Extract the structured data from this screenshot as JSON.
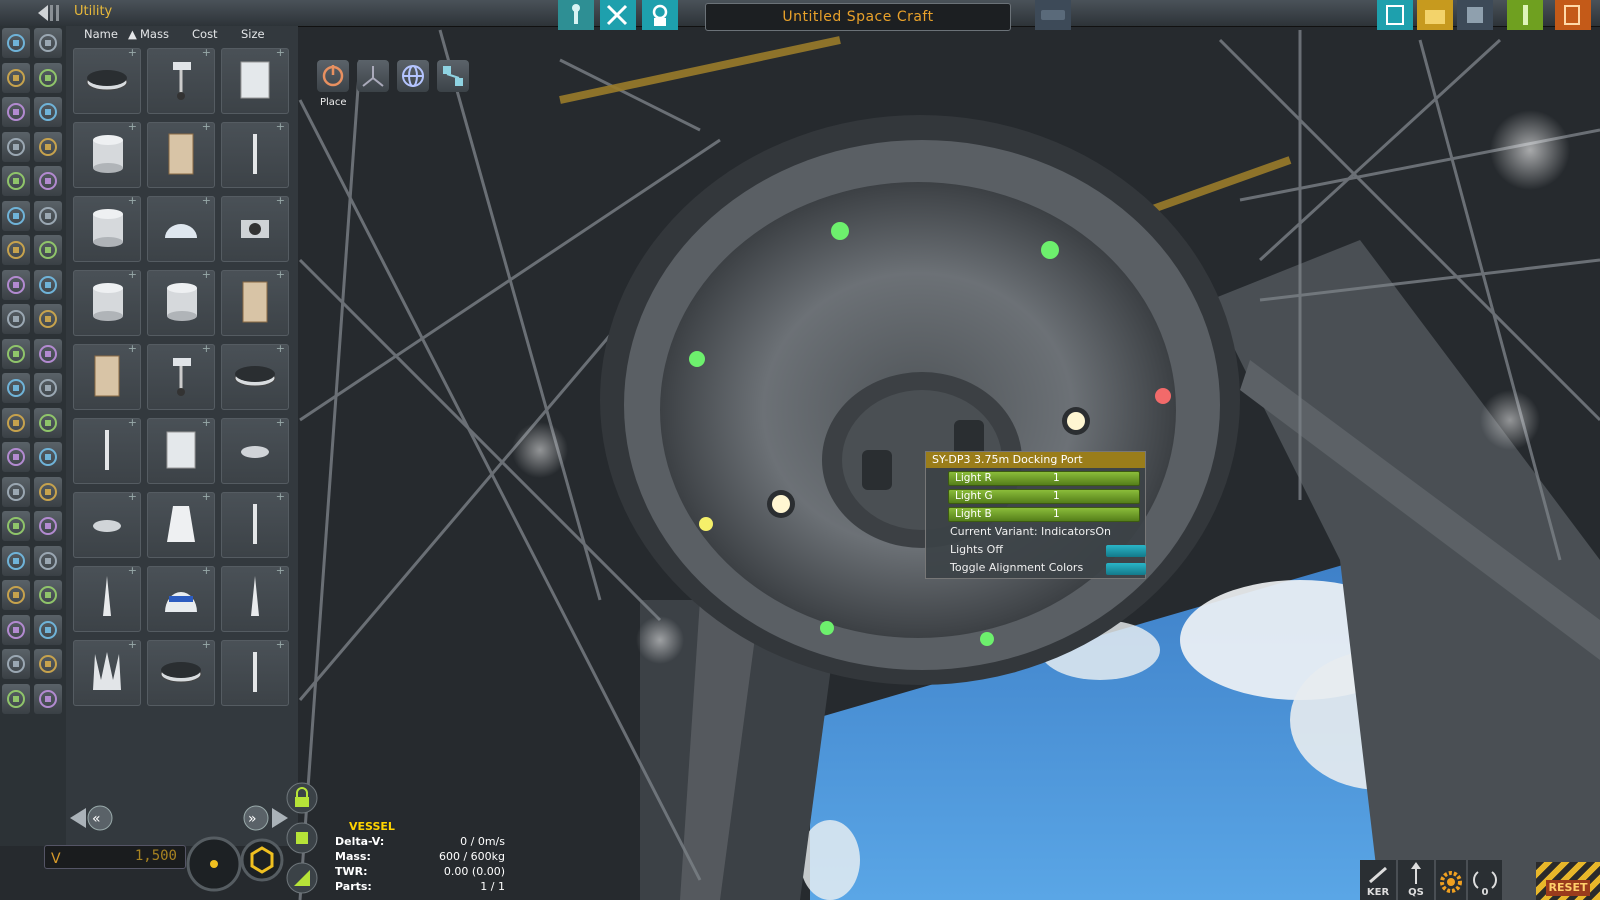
{
  "editor": {
    "category_title": "Utility",
    "craft_name": "Untitled Space Craft",
    "sort_columns": [
      "Name",
      "Mass",
      "Cost",
      "Size"
    ],
    "sort_active_indicator": "▲",
    "tool_place_label": "Place",
    "funds": "1,500"
  },
  "vessel_info": {
    "title": "VESSEL",
    "rows": [
      {
        "label": "Delta-V:",
        "value": "0 / 0m/s"
      },
      {
        "label": "Mass:",
        "value": "600 / 600kg"
      },
      {
        "label": "TWR:",
        "value": "0.00 (0.00)"
      },
      {
        "label": "Parts:",
        "value": "1 / 1"
      }
    ]
  },
  "part_action_window": {
    "title": "SY-DP3 3.75m Docking Port",
    "sliders": [
      {
        "label": "Light R",
        "value": "1"
      },
      {
        "label": "Light G",
        "value": "1"
      },
      {
        "label": "Light B",
        "value": "1"
      }
    ],
    "variant_text": "Current Variant: IndicatorsOn",
    "toggles": [
      {
        "label": "Lights Off"
      },
      {
        "label": "Toggle Alignment Colors"
      }
    ]
  },
  "bottom_right": {
    "ker_label": "KER",
    "qs_label": "QS",
    "antenna_count": "0",
    "reset_label": "RESET"
  },
  "colors": {
    "accent_yellow": "#e8b93a",
    "craft_name": "#e8a12a",
    "slider_green": "#7fb032",
    "toggle_cyan": "#2ab6c8",
    "pam_title_bg": "#9a7d1a"
  },
  "icons": {
    "category_icons": [
      "function-icon",
      "pod-icon",
      "fuel-tank-icon",
      "engine-icon",
      "command-icon",
      "structural-icon",
      "aero-icon",
      "control-icon",
      "coupling-icon",
      "payload-icon",
      "utility-icon",
      "science-icon",
      "electrical-icon",
      "thermal-icon",
      "ground-icon",
      "robotics-icon",
      "cargo-icon",
      "communication-icon",
      "squad-icon",
      "custom-icon"
    ]
  }
}
